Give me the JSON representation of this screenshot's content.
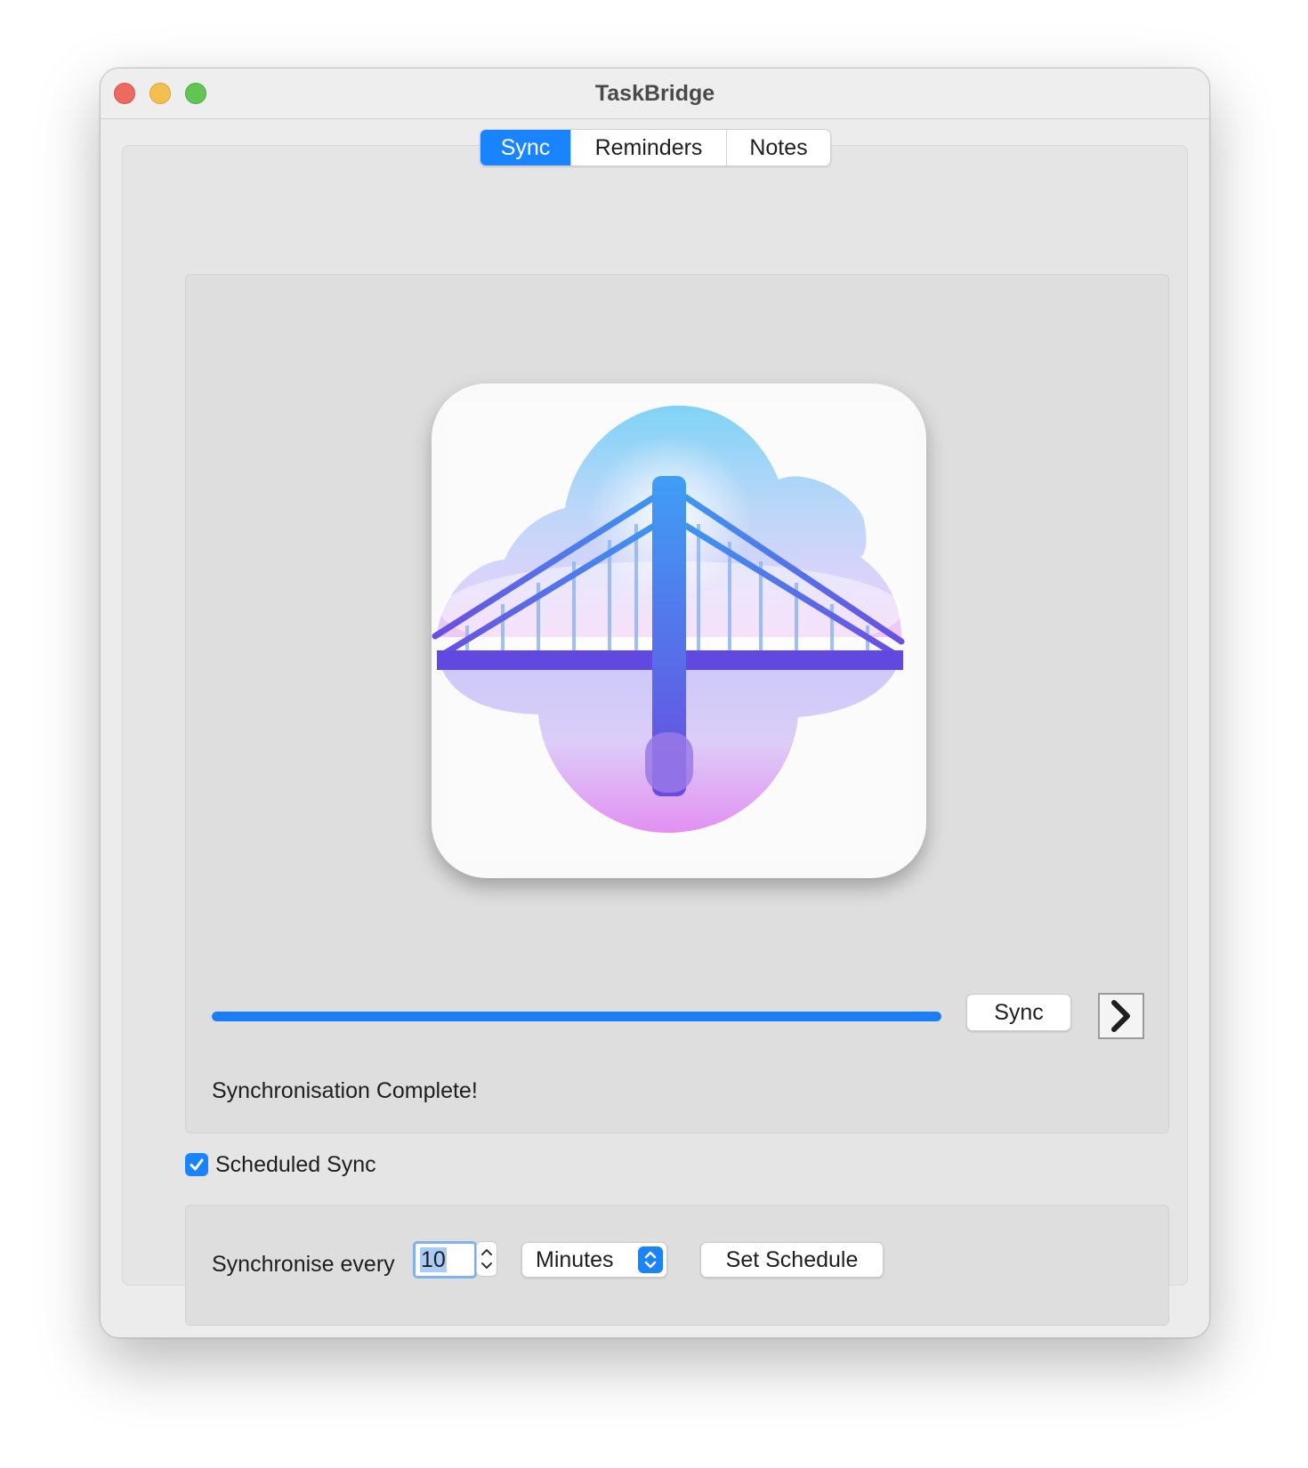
{
  "window": {
    "title": "TaskBridge"
  },
  "tabs": [
    {
      "label": "Sync",
      "active": true
    },
    {
      "label": "Reminders",
      "active": false
    },
    {
      "label": "Notes",
      "active": false
    }
  ],
  "sync": {
    "app_icon": "taskbridge-bridge-cloud-icon",
    "progress_percent": 100,
    "sync_button_label": "Sync",
    "expand_icon": "chevron-right-icon",
    "status_text": "Synchronisation Complete!"
  },
  "schedule": {
    "checkbox_label": "Scheduled Sync",
    "checked": true,
    "label": "Synchronise every",
    "interval_value": "10",
    "unit_selected": "Minutes",
    "set_button_label": "Set Schedule"
  },
  "colors": {
    "accent": "#1a84ff",
    "close": "#ed6a5e",
    "minimize": "#f5bf4f",
    "maximize": "#61c554"
  }
}
